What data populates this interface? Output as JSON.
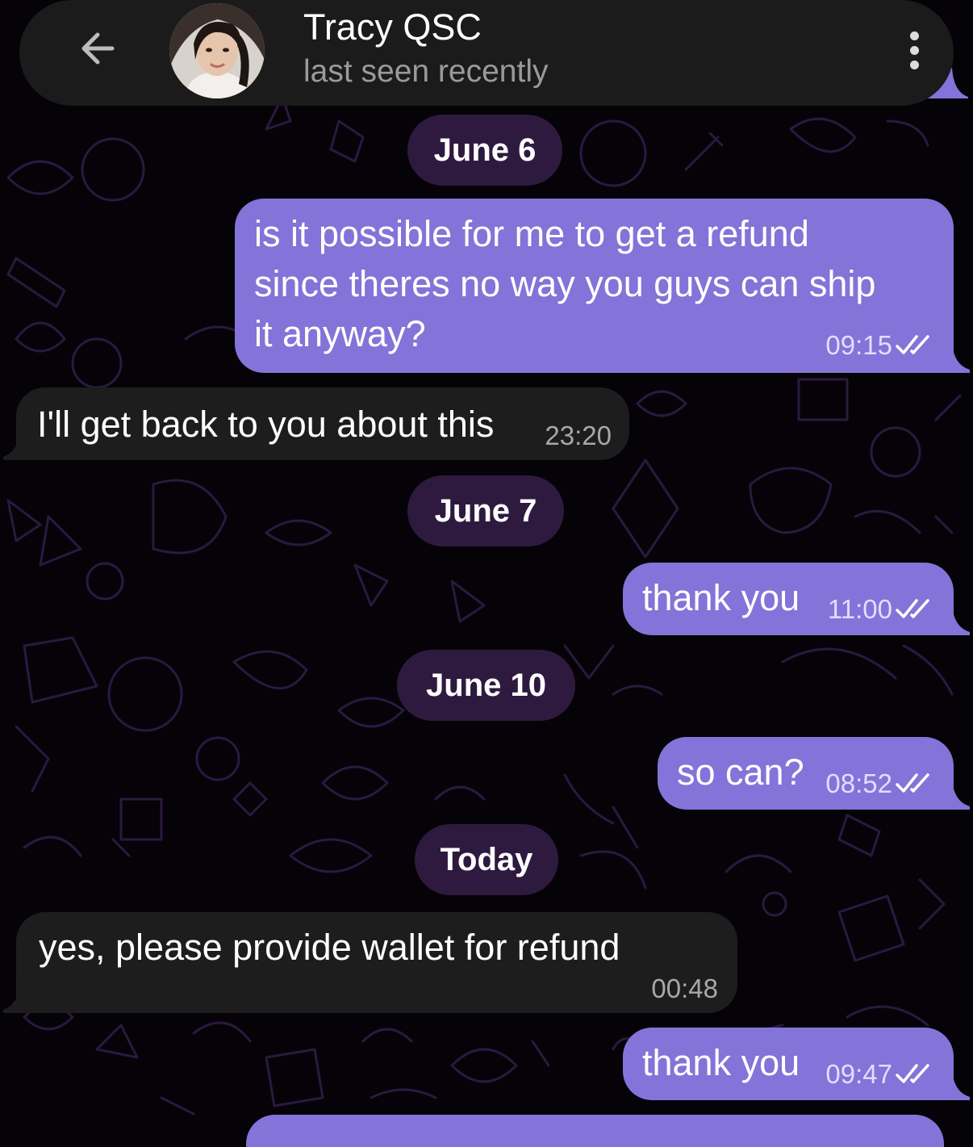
{
  "header": {
    "contact_name": "Tracy QSC",
    "status": "last seen recently",
    "back_icon": "arrow-left-icon",
    "menu_icon": "more-vertical-icon"
  },
  "theme": {
    "header_bg": "#1b1b1b",
    "outgoing_bubble": "#8473d8",
    "incoming_bubble": "#1d1d1d",
    "date_chip_bg": "#2f1a3f",
    "wallpaper": "#050307",
    "doodle_stroke": "#2a1940"
  },
  "messages": [
    {
      "type": "date",
      "text": "June 6"
    },
    {
      "type": "outgoing",
      "text": "is it possible for me to get a refund since theres no way you guys can ship it anyway?",
      "lines": [
        "is it possible for me to get a refund",
        "since theres no way you guys can ship",
        "it anyway?"
      ],
      "time": "09:15",
      "status": "read"
    },
    {
      "type": "incoming",
      "text": "I'll get back to you about this",
      "time": "23:20"
    },
    {
      "type": "date",
      "text": "June 7"
    },
    {
      "type": "outgoing",
      "text": "thank you",
      "time": "11:00",
      "status": "read"
    },
    {
      "type": "date",
      "text": "June 10"
    },
    {
      "type": "outgoing",
      "text": "so can?",
      "time": "08:52",
      "status": "read"
    },
    {
      "type": "date",
      "text": "Today"
    },
    {
      "type": "incoming",
      "text": "yes, please provide wallet for refund",
      "time": "00:48"
    },
    {
      "type": "outgoing",
      "text": "thank you",
      "time": "09:47",
      "status": "read"
    }
  ]
}
